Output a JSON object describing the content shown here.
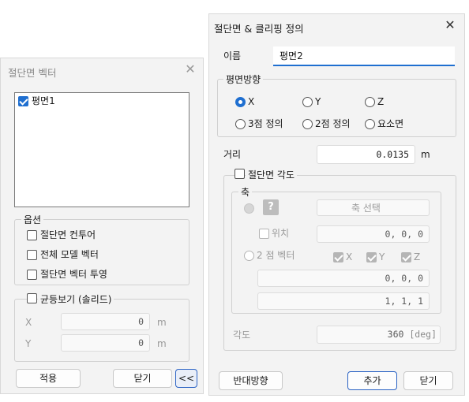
{
  "left_dialog": {
    "title": "절단면 벡터",
    "list_items": [
      {
        "label": "평면1",
        "checked": true
      }
    ],
    "options": {
      "legend": "옵션",
      "items": [
        {
          "label": "절단면 컨투어",
          "checked": false
        },
        {
          "label": "전체 모델 벡터",
          "checked": false
        },
        {
          "label": "절단면 벡터 투영",
          "checked": false
        }
      ]
    },
    "iso": {
      "legend": "균등보기 (솔리드)",
      "x_label": "X",
      "x_value": "0",
      "x_unit": "m",
      "y_label": "Y",
      "y_value": "0",
      "y_unit": "m"
    },
    "buttons": {
      "apply": "적용",
      "close": "닫기",
      "collapse": "<<"
    }
  },
  "right_dialog": {
    "title": "절단면 & 클리핑 정의",
    "name_label": "이름",
    "name_value": "평면2",
    "plane_direction": {
      "legend": "평면방향",
      "options": [
        "X",
        "Y",
        "Z",
        "3점 정의",
        "2점 정의",
        "요소면"
      ],
      "selected": "X"
    },
    "distance": {
      "label": "거리",
      "value": "0.0135",
      "unit": "m"
    },
    "angle_section": {
      "legend": "절단면 각도",
      "axis_legend": "축",
      "axis_select_label": "축 선택",
      "position_label": "위치",
      "position_value": "0, 0, 0",
      "two_point_label": "2 점 벡터",
      "x_label": "X",
      "y_label": "Y",
      "z_label": "Z",
      "vec1_value": "0, 0, 0",
      "vec2_value": "1, 1, 1"
    },
    "angle": {
      "label": "각도",
      "value": "360",
      "unit": "[deg]"
    },
    "buttons": {
      "reverse": "반대방향",
      "add": "추가",
      "close": "닫기"
    }
  },
  "colors": {
    "accent": "#1f6fd0",
    "dialog_bg": "#f3f3f3",
    "disabled_text": "#9a9a9a"
  }
}
